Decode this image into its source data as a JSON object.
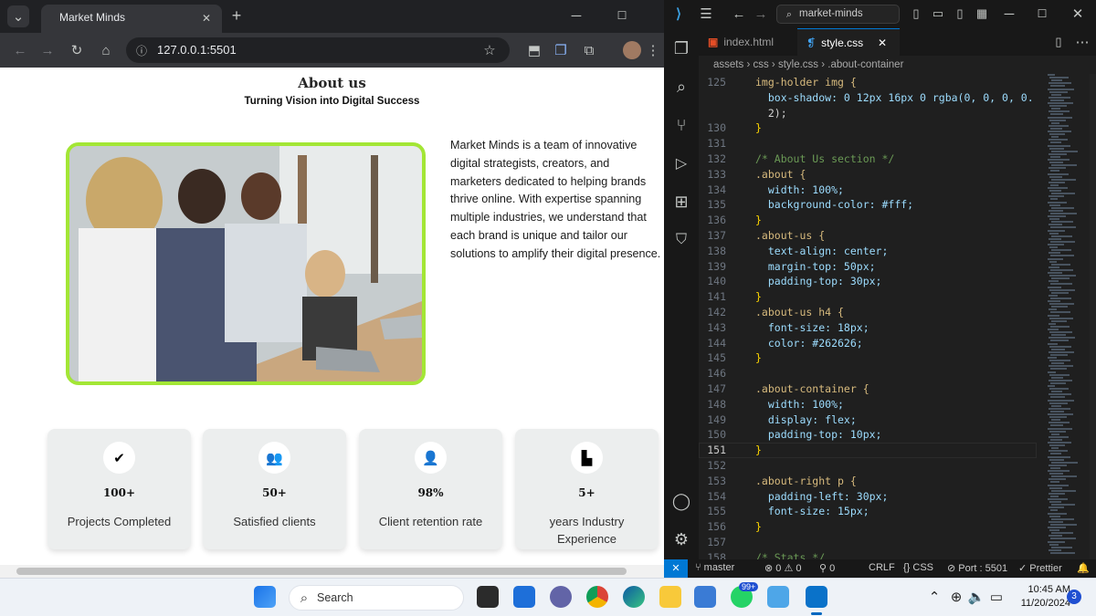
{
  "browser": {
    "tab_title": "Market Minds",
    "url": "127.0.0.1:5501"
  },
  "page": {
    "about_title": "About us",
    "about_subtitle": "Turning Vision into Digital Success",
    "about_text": "Market Minds is a team of innovative digital strategists, creators, and marketers dedicated to helping brands thrive online. With expertise spanning multiple industries, we understand that each brand is unique and tailor our solutions to amplify their digital presence.",
    "stats": [
      {
        "icon": "double-check-icon",
        "value": "100+",
        "label": "Projects Completed"
      },
      {
        "icon": "users-icon",
        "value": "50+",
        "label": "Satisfied clients"
      },
      {
        "icon": "user-plus-icon",
        "value": "98%",
        "label": "Client retention rate"
      },
      {
        "icon": "industry-icon",
        "value": "5+",
        "label": "years Industry Experience"
      }
    ]
  },
  "vscode": {
    "search": "market-minds",
    "tabs": [
      "index.html",
      "style.css"
    ],
    "breadcrumb": [
      "assets",
      "css",
      "style.css",
      ".about-container"
    ],
    "lines": [
      {
        "n": "125",
        "code": "img-holder img {"
      },
      {
        "n": "",
        "code": "  box-shadow: 0 12px 16px 0 rgba(0, 0, 0, 0."
      },
      {
        "n": "",
        "code": "  2);"
      },
      {
        "n": "130",
        "code": "}"
      },
      {
        "n": "131",
        "code": ""
      },
      {
        "n": "132",
        "code": "/* About Us section */"
      },
      {
        "n": "133",
        "code": ".about {"
      },
      {
        "n": "134",
        "code": "  width: 100%;"
      },
      {
        "n": "135",
        "code": "  background-color: #fff;"
      },
      {
        "n": "136",
        "code": "}"
      },
      {
        "n": "137",
        "code": ".about-us {"
      },
      {
        "n": "138",
        "code": "  text-align: center;"
      },
      {
        "n": "139",
        "code": "  margin-top: 50px;"
      },
      {
        "n": "140",
        "code": "  padding-top: 30px;"
      },
      {
        "n": "141",
        "code": "}"
      },
      {
        "n": "142",
        "code": ".about-us h4 {"
      },
      {
        "n": "143",
        "code": "  font-size: 18px;"
      },
      {
        "n": "144",
        "code": "  color: #262626;"
      },
      {
        "n": "145",
        "code": "}"
      },
      {
        "n": "146",
        "code": ""
      },
      {
        "n": "147",
        "code": ".about-container {"
      },
      {
        "n": "148",
        "code": "  width: 100%;"
      },
      {
        "n": "149",
        "code": "  display: flex;"
      },
      {
        "n": "150",
        "code": "  padding-top: 10px;"
      },
      {
        "n": "151",
        "code": "}"
      },
      {
        "n": "152",
        "code": ""
      },
      {
        "n": "153",
        "code": ".about-right p {"
      },
      {
        "n": "154",
        "code": "  padding-left: 30px;"
      },
      {
        "n": "155",
        "code": "  font-size: 15px;"
      },
      {
        "n": "156",
        "code": "}"
      },
      {
        "n": "157",
        "code": ""
      },
      {
        "n": "158",
        "code": "/* Stats */"
      }
    ],
    "status": {
      "branch": "master",
      "problems": "0 ⚠ 0",
      "ports": "0",
      "eol": "CRLF",
      "lang": "CSS",
      "port": "Port : 5501",
      "prettier": "Prettier"
    }
  },
  "taskbar": {
    "search_placeholder": "Search",
    "time": "10:45 AM",
    "date": "11/20/2024",
    "notif_count": "3",
    "whatsapp_badge": "99+"
  },
  "colors": {
    "accent_green": "#a3e635",
    "vscode_blue": "#0078d4"
  }
}
